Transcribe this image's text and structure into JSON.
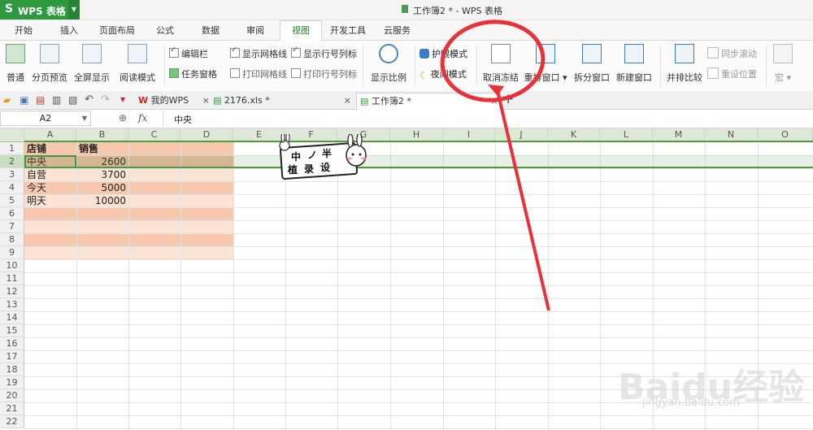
{
  "app": {
    "name": "WPS 表格",
    "logo": "S",
    "window_title": "工作簿2 * - WPS 表格"
  },
  "ribbon_tabs": [
    "开始",
    "插入",
    "页面布局",
    "公式",
    "数据",
    "审阅",
    "视图",
    "开发工具",
    "云服务"
  ],
  "active_tab": "视图",
  "ribbon": {
    "normal": "普通",
    "page_preview": "分页预览",
    "fullscreen": "全屏显示",
    "read_mode": "阅读模式",
    "edit_bar": "编辑栏",
    "task_pane": "任务窗格",
    "show_gridlines": "显示网格线",
    "print_gridlines": "打印网格线",
    "show_headers": "显示行号列标",
    "print_headers": "打印行号列标",
    "zoom": "显示比例",
    "eye_mode": "护眼模式",
    "night_mode": "夜间模式",
    "unfreeze": "取消冻结",
    "arrange": "重排窗口",
    "split": "拆分窗口",
    "new_window": "新建窗口",
    "side_by_side": "并排比较",
    "sync_scroll": "同步滚动",
    "reset_pos": "重设位置",
    "macro": "宏"
  },
  "doc_tabs": [
    {
      "label": "我的WPS"
    },
    {
      "label": "2176.xls *"
    },
    {
      "label": "工作簿2 *"
    }
  ],
  "new_tab": "+",
  "formula_bar": {
    "name_box": "A2",
    "fx": "fx",
    "value": "中央"
  },
  "columns": [
    "A",
    "B",
    "C",
    "D",
    "E",
    "F",
    "G",
    "H",
    "I",
    "J",
    "K",
    "L",
    "M",
    "N",
    "O"
  ],
  "rows": [
    "1",
    "2",
    "3",
    "4",
    "5",
    "6",
    "7",
    "8",
    "9",
    "10",
    "11",
    "12",
    "13",
    "14",
    "15",
    "16",
    "17",
    "18",
    "19",
    "20",
    "21",
    "22"
  ],
  "table": {
    "headers": [
      "店铺",
      "销售"
    ],
    "data": [
      [
        "中央",
        "2600"
      ],
      [
        "自营",
        "3700"
      ],
      [
        "今天",
        "5000"
      ],
      [
        "明天",
        "10000"
      ]
    ]
  },
  "sticker": {
    "text1": "中",
    "text2": "ノ",
    "text3": "半",
    "text4": "植",
    "text5": "录",
    "text6": "设"
  },
  "watermark": {
    "main": "Baidu经验",
    "sub": "jingyan.baidu.com"
  },
  "colors": {
    "brand": "#2c9a3c",
    "freeze_line": "#4e9a3c",
    "band_dark": "#f6c9ae",
    "band_light": "#fbe3d6",
    "annotation": "#e8323a"
  }
}
